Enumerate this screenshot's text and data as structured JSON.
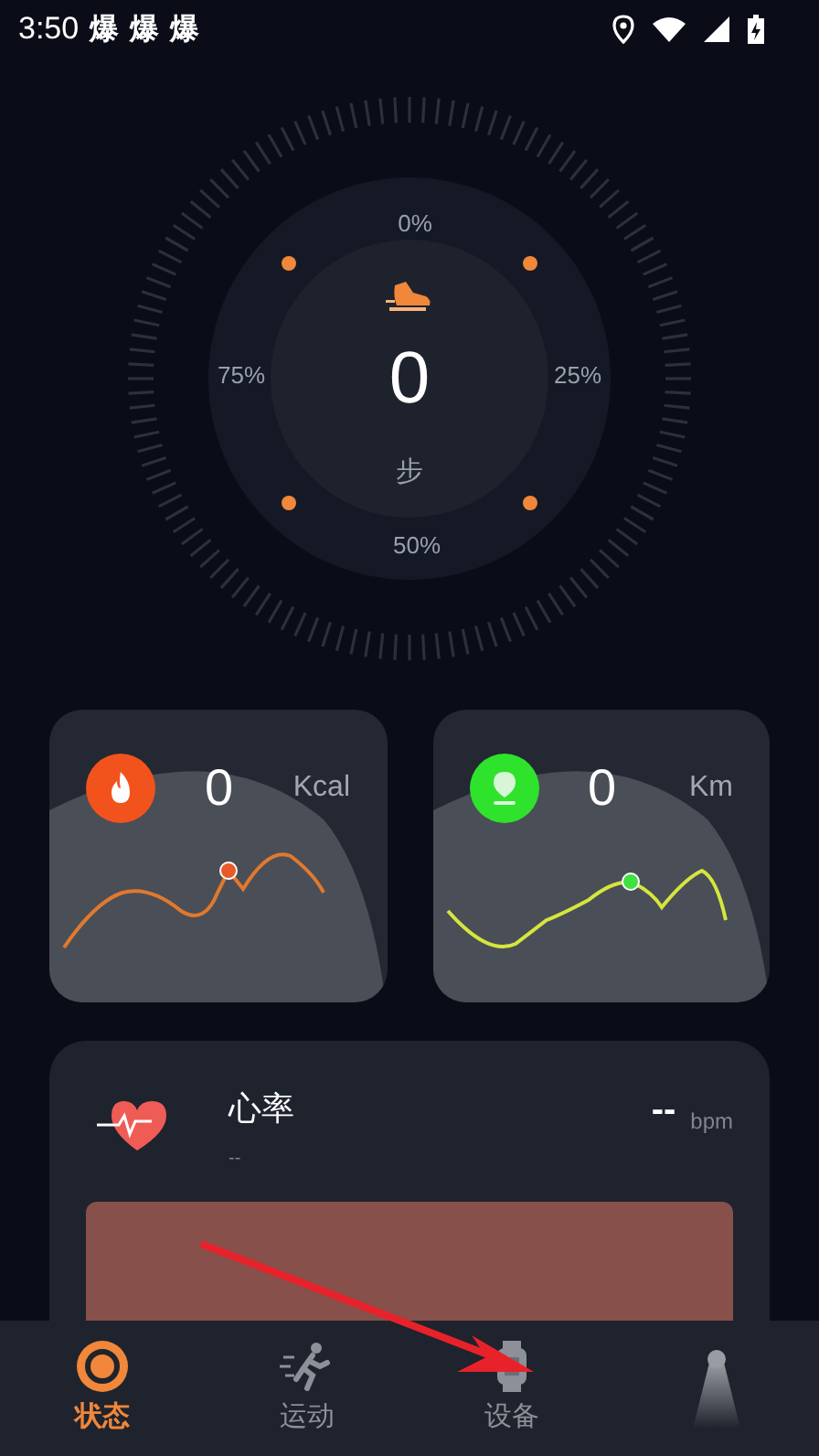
{
  "status_bar": {
    "time": "3:50",
    "notifications": [
      "爆",
      "爆",
      "爆"
    ]
  },
  "steps": {
    "value": "0",
    "unit": "步",
    "marks": [
      "0%",
      "25%",
      "50%",
      "75%"
    ]
  },
  "cards": [
    {
      "kind": "calories",
      "value": "0",
      "unit": "Kcal"
    },
    {
      "kind": "distance",
      "value": "0",
      "unit": "Km"
    }
  ],
  "heart_rate": {
    "title": "心率",
    "subtitle": "--",
    "value": "--",
    "unit": "bpm"
  },
  "nav": [
    {
      "kind": "status",
      "label": "状态",
      "selected": true
    },
    {
      "kind": "sport",
      "label": "运动",
      "selected": false
    },
    {
      "kind": "device",
      "label": "设备",
      "selected": false
    },
    {
      "kind": "lamp",
      "selected": false
    }
  ]
}
